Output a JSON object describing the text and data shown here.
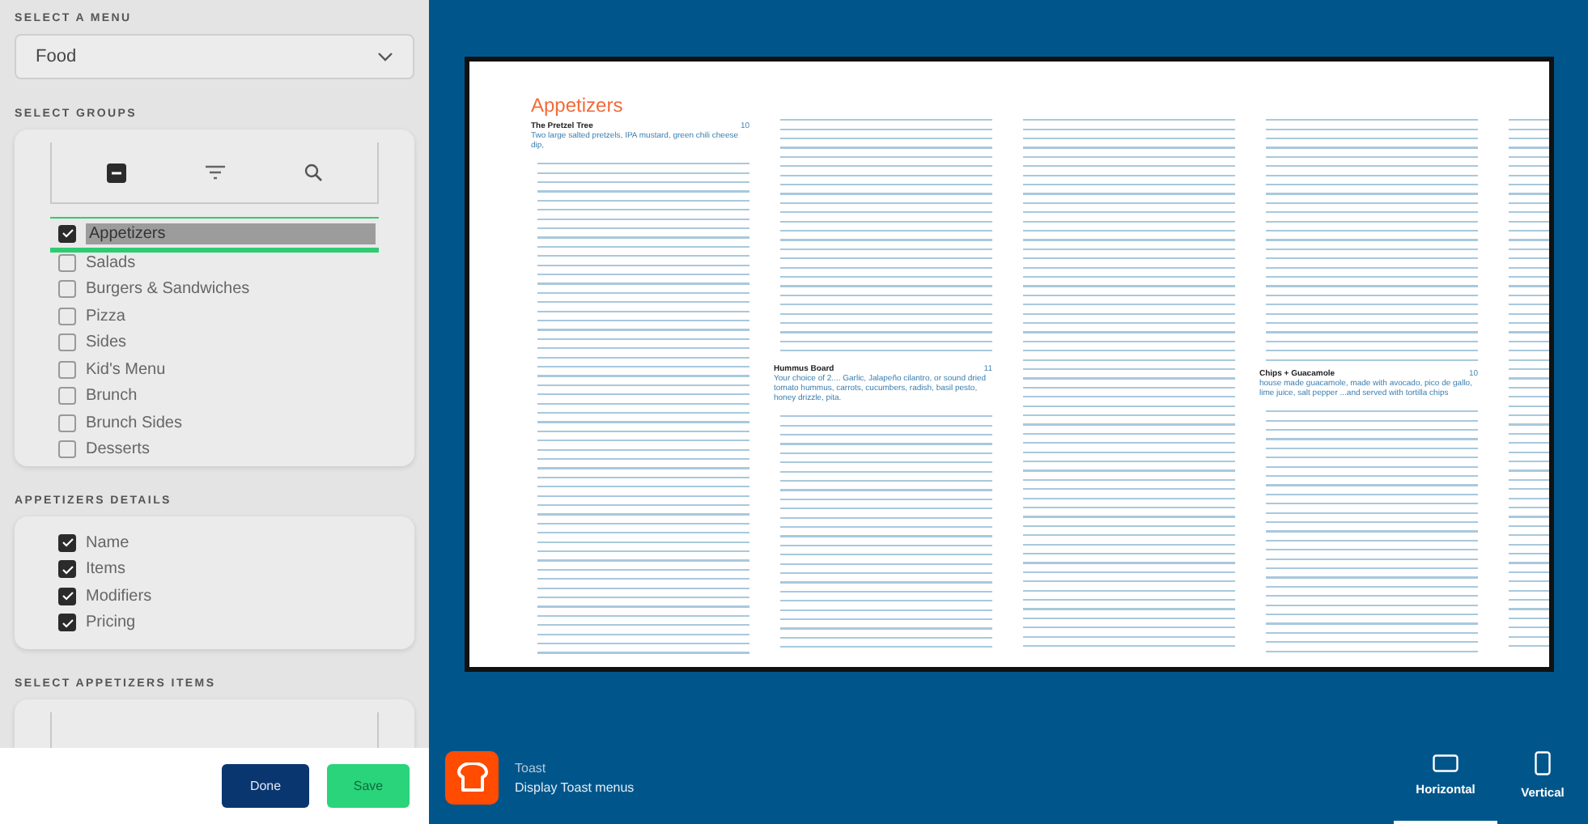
{
  "sidebar": {
    "menu_label": "SELECT A MENU",
    "menu_value": "Food",
    "groups_label": "SELECT GROUPS",
    "groups": [
      {
        "label": "Appetizers",
        "checked": true,
        "selected": true
      },
      {
        "label": "Salads",
        "checked": false,
        "selected": false
      },
      {
        "label": "Burgers & Sandwiches",
        "checked": false,
        "selected": false
      },
      {
        "label": "Pizza",
        "checked": false,
        "selected": false
      },
      {
        "label": "Sides",
        "checked": false,
        "selected": false
      },
      {
        "label": "Kid's Menu",
        "checked": false,
        "selected": false
      },
      {
        "label": "Brunch",
        "checked": false,
        "selected": false
      },
      {
        "label": "Brunch Sides",
        "checked": false,
        "selected": false
      },
      {
        "label": "Desserts",
        "checked": false,
        "selected": false
      }
    ],
    "details_label": "APPETIZERS DETAILS",
    "details": [
      {
        "label": "Name",
        "checked": true
      },
      {
        "label": "Items",
        "checked": true
      },
      {
        "label": "Modifiers",
        "checked": true
      },
      {
        "label": "Pricing",
        "checked": true
      }
    ],
    "items_label": "SELECT APPETIZERS ITEMS"
  },
  "footer_buttons": [
    {
      "label": "Done",
      "kind": "primary"
    },
    {
      "label": "Save",
      "kind": "save"
    }
  ],
  "preview": {
    "title": "Appetizers",
    "columns": [
      {
        "blocks": [
          {
            "kind": "heading",
            "name": "The Pretzel Tree",
            "price": "10",
            "description": "Two large salted pretzels, IPA mustard, green chili cheese dip,"
          },
          {
            "kind": "lines"
          }
        ]
      },
      {
        "blocks": [
          {
            "kind": "lines"
          },
          {
            "kind": "heading",
            "name": "Hummus Board",
            "price": "11",
            "description": "Your choice of 2.... Garlic, Jalapeño cilantro, or sound dried tomato hummus, carrots, cucumbers, radish, basil pesto, honey drizzle, pita."
          },
          {
            "kind": "lines"
          }
        ]
      },
      {
        "blocks": [
          {
            "kind": "lines"
          }
        ]
      },
      {
        "blocks": [
          {
            "kind": "lines"
          },
          {
            "kind": "heading",
            "name": "Chips + Guacamole",
            "price": "10",
            "description": "house made guacamole, made with avocado, pico de gallo, lime juice, salt pepper ...and served with tortilla chips"
          },
          {
            "kind": "lines"
          }
        ]
      },
      {
        "blocks": [
          {
            "kind": "lines"
          }
        ]
      }
    ]
  },
  "app": {
    "name": "Toast",
    "description": "Display Toast menus"
  },
  "orientations": [
    {
      "label": "Horizontal",
      "kind": "horizontal",
      "selected": true
    },
    {
      "label": "Vertical",
      "kind": "vertical",
      "selected": false
    }
  ]
}
